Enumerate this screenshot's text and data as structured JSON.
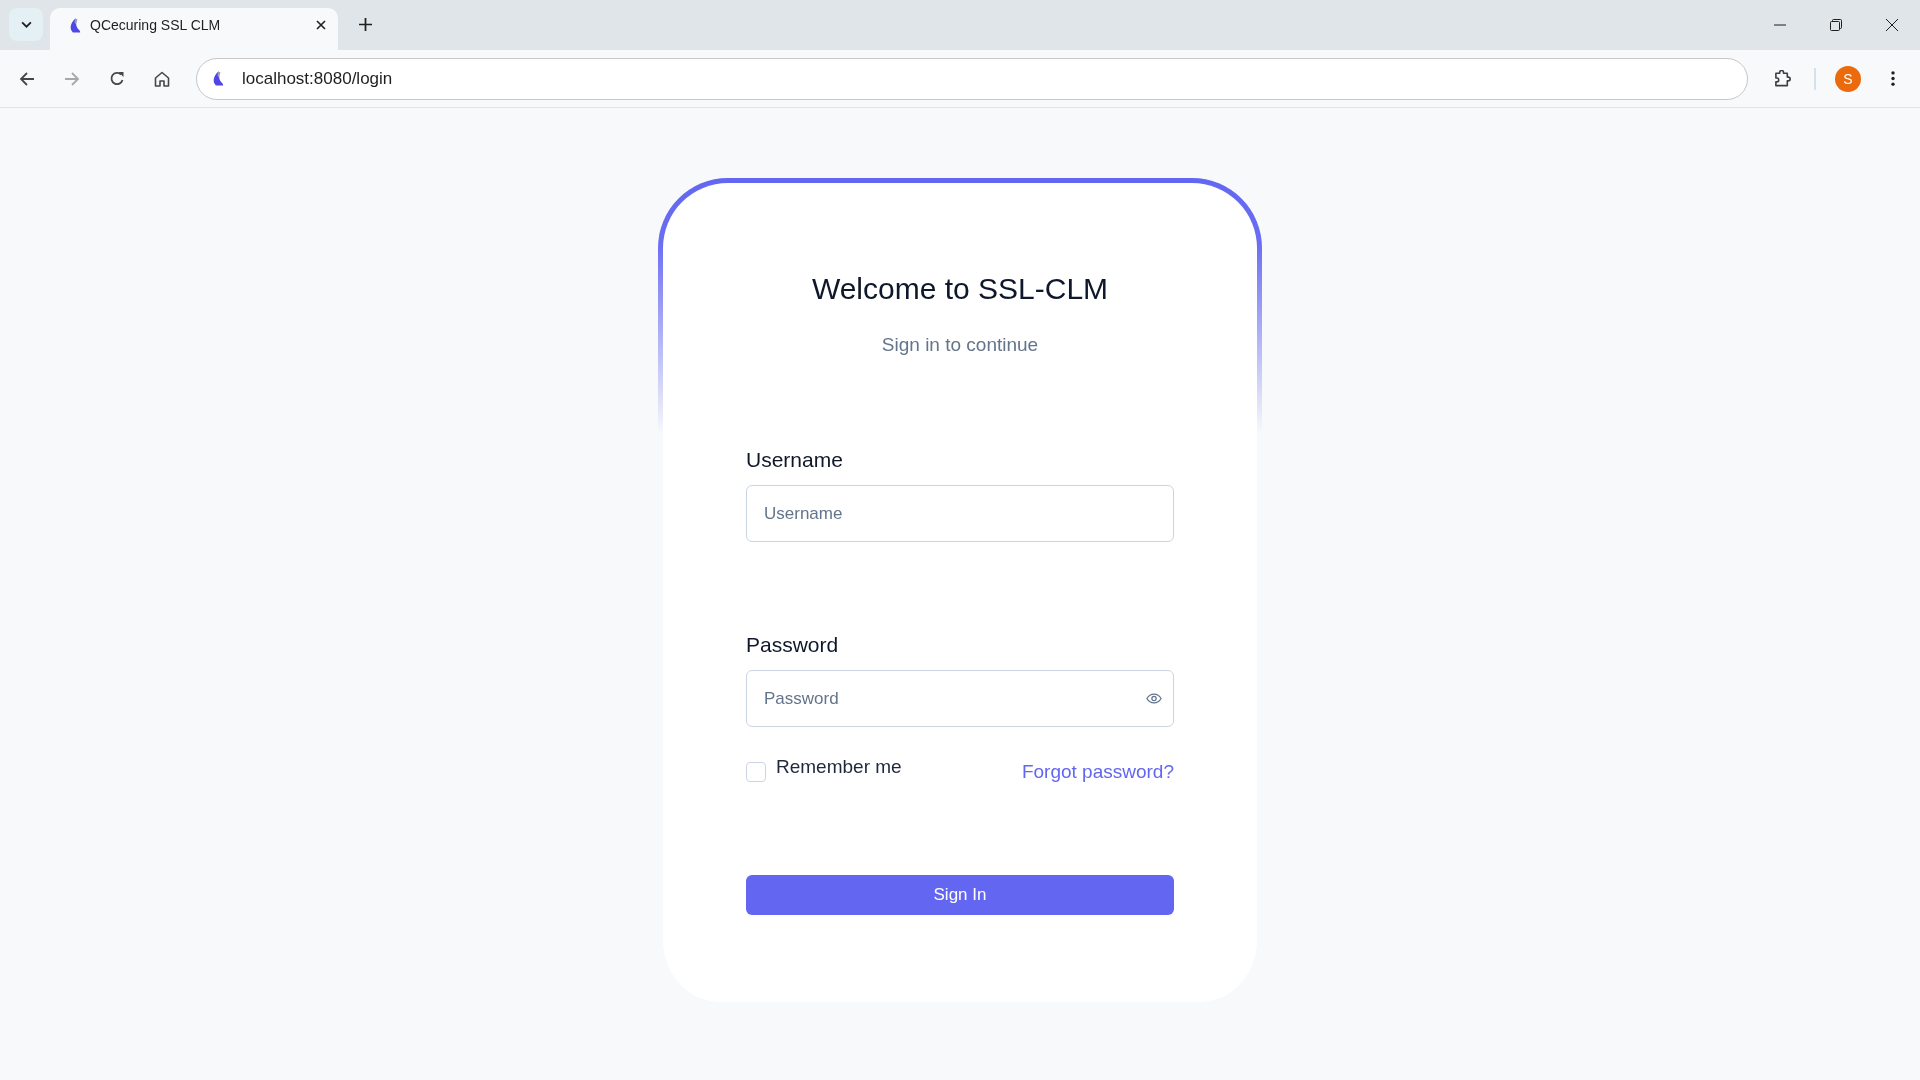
{
  "browser": {
    "tabs": [
      {
        "title": "QCecuring SSL CLM",
        "selected": true
      }
    ],
    "nav_buttons": [
      {
        "kind": "back",
        "disabled": false
      },
      {
        "kind": "forward",
        "disabled": true
      },
      {
        "kind": "reload",
        "disabled": false
      },
      {
        "kind": "home",
        "disabled": false
      }
    ],
    "address": "localhost:8080/login",
    "profile_initial": "S"
  },
  "login": {
    "title": "Welcome to SSL-CLM",
    "subtitle": "Sign in to continue",
    "fields": [
      {
        "kind": "text",
        "label": "Username",
        "placeholder": "Username"
      },
      {
        "kind": "password",
        "label": "Password",
        "placeholder": "Password"
      }
    ],
    "remember": {
      "label": "Remember me",
      "checked": false
    },
    "forgot_link": "Forgot password?",
    "submit": "Sign In"
  }
}
